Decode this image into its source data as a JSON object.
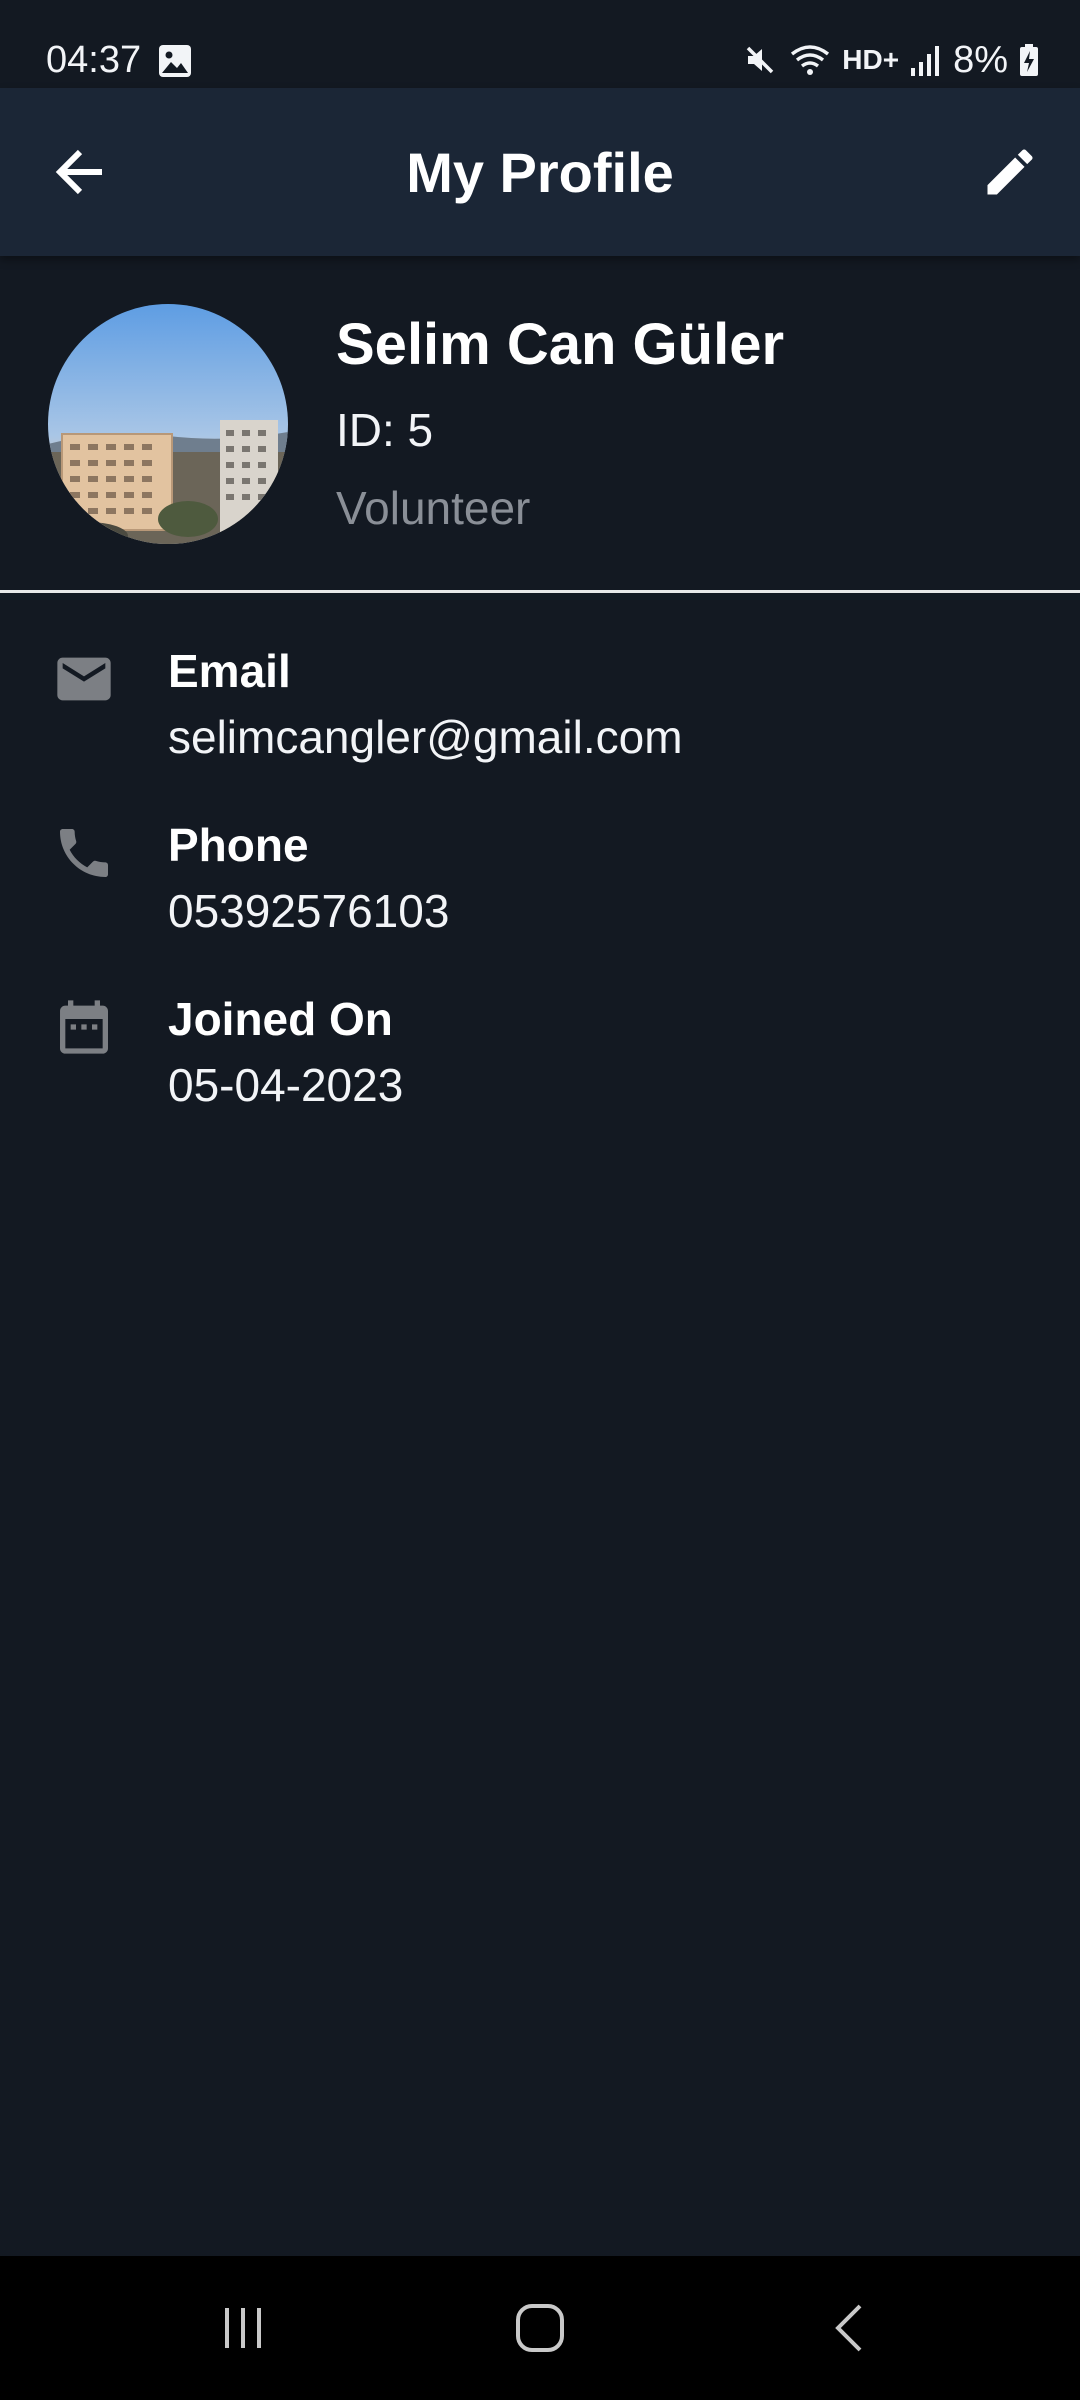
{
  "status_bar": {
    "time": "04:37",
    "battery": "8%",
    "network": "HD+",
    "icons": [
      "gallery-icon",
      "mute-icon",
      "wifi-icon",
      "signal-icon",
      "battery-charging-icon"
    ]
  },
  "app_bar": {
    "title": "My Profile",
    "back_icon": "arrow-left-icon",
    "edit_icon": "pencil-icon"
  },
  "profile": {
    "name": "Selim Can Güler",
    "id": "ID: 5",
    "role": "Volunteer"
  },
  "info": {
    "email": {
      "label": "Email",
      "value": "selimcangler@gmail.com",
      "icon": "email-icon"
    },
    "phone": {
      "label": "Phone",
      "value": "05392576103",
      "icon": "phone-icon"
    },
    "joined": {
      "label": "Joined On",
      "value": "05-04-2023",
      "icon": "calendar-icon"
    }
  },
  "nav_bar": {
    "icons": [
      "recent-apps-icon",
      "home-icon",
      "back-icon"
    ]
  },
  "colors": {
    "background": "#131922",
    "app_bar": "#1b2636",
    "muted_text": "#8a8f97",
    "icon_grey": "#7c7f84"
  }
}
